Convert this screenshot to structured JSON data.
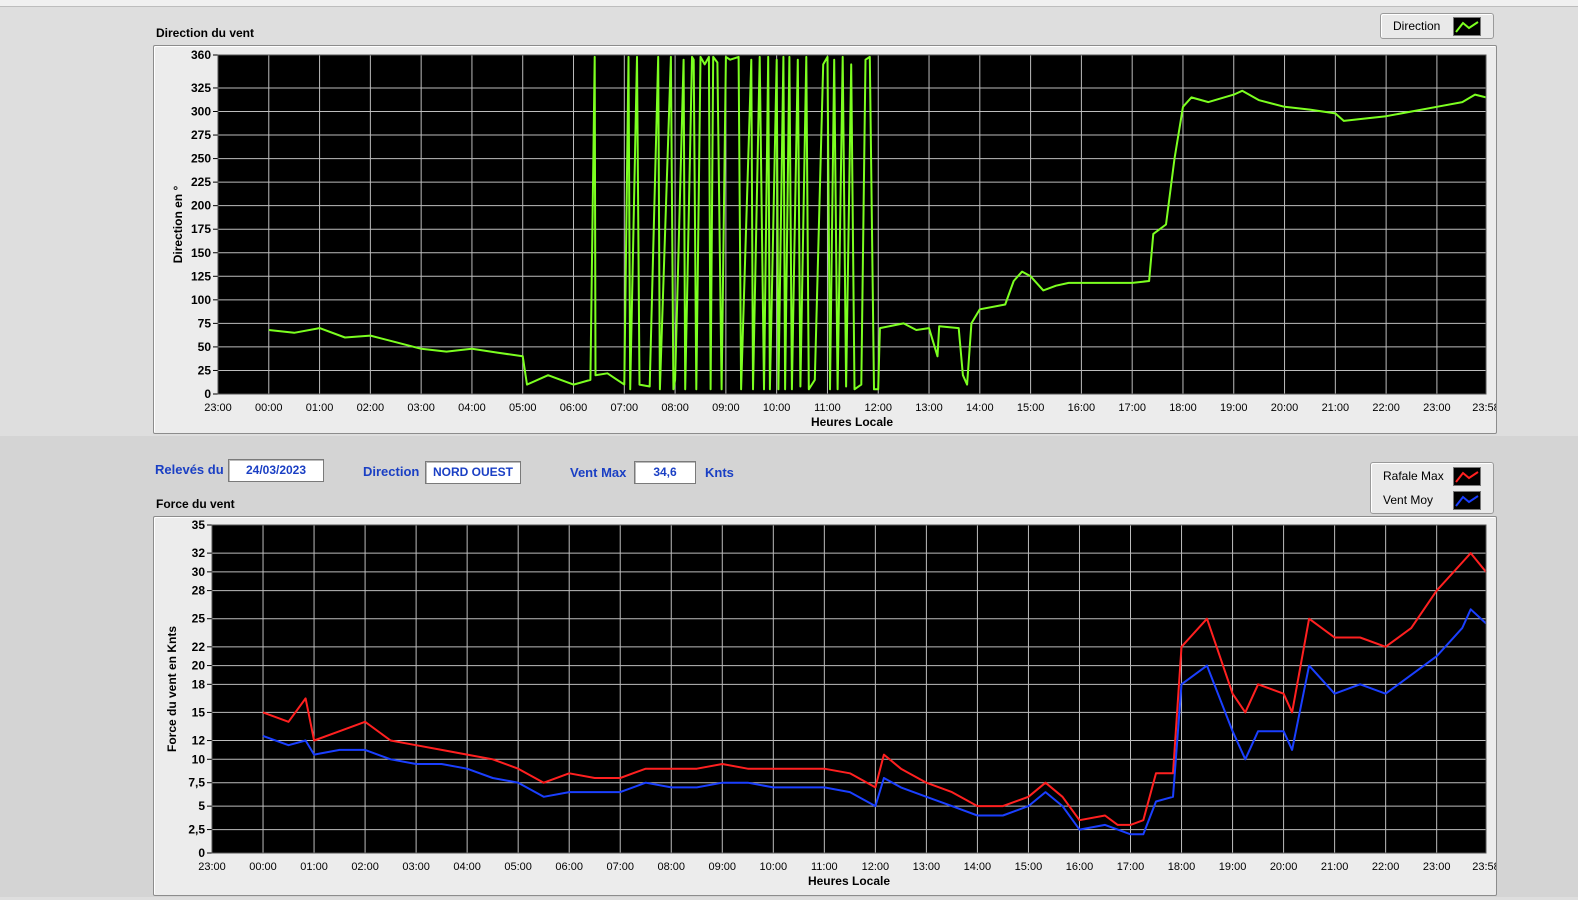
{
  "top_chart": {
    "title": "Direction du vent",
    "legend": [
      {
        "label": "Direction",
        "color": "#7cff20",
        "icon": "line-swatch-icon"
      }
    ],
    "chart_data": {
      "type": "line",
      "title": "Direction du vent",
      "xlabel": "Heures Locale",
      "ylabel": "Direction en °",
      "x_ticks": [
        "23:00",
        "00:00",
        "01:00",
        "02:00",
        "03:00",
        "04:00",
        "05:00",
        "06:00",
        "07:00",
        "08:00",
        "09:00",
        "10:00",
        "11:00",
        "12:00",
        "13:00",
        "14:00",
        "15:00",
        "16:00",
        "17:00",
        "18:00",
        "19:00",
        "20:00",
        "21:00",
        "22:00",
        "23:00",
        "23:58"
      ],
      "y_ticks": [
        "0",
        "25",
        "50",
        "75",
        "100",
        "125",
        "150",
        "175",
        "200",
        "225",
        "250",
        "275",
        "300",
        "325",
        "360"
      ],
      "ylim": [
        0,
        360
      ],
      "grid": true,
      "series": [
        {
          "name": "Direction",
          "color": "#7cff20",
          "points": [
            [
              "00:00",
              68
            ],
            [
              "00:30",
              65
            ],
            [
              "01:00",
              70
            ],
            [
              "01:30",
              60
            ],
            [
              "02:00",
              62
            ],
            [
              "02:30",
              55
            ],
            [
              "03:00",
              48
            ],
            [
              "03:30",
              45
            ],
            [
              "04:00",
              48
            ],
            [
              "04:30",
              44
            ],
            [
              "05:00",
              40
            ],
            [
              "05:05",
              10
            ],
            [
              "05:30",
              20
            ],
            [
              "06:00",
              10
            ],
            [
              "06:20",
              15
            ],
            [
              "06:25",
              358
            ],
            [
              "06:26",
              20
            ],
            [
              "06:40",
              22
            ],
            [
              "07:00",
              10
            ],
            [
              "07:05",
              358
            ],
            [
              "07:07",
              5
            ],
            [
              "07:15",
              358
            ],
            [
              "07:18",
              10
            ],
            [
              "07:30",
              8
            ],
            [
              "07:40",
              358
            ],
            [
              "07:42",
              5
            ],
            [
              "07:55",
              358
            ],
            [
              "07:58",
              5
            ],
            [
              "08:00",
              15
            ],
            [
              "08:10",
              355
            ],
            [
              "08:12",
              5
            ],
            [
              "08:20",
              358
            ],
            [
              "08:22",
              355
            ],
            [
              "08:25",
              5
            ],
            [
              "08:30",
              358
            ],
            [
              "08:35",
              350
            ],
            [
              "08:40",
              358
            ],
            [
              "08:42",
              5
            ],
            [
              "08:45",
              358
            ],
            [
              "08:50",
              352
            ],
            [
              "08:55",
              5
            ],
            [
              "09:00",
              358
            ],
            [
              "09:05",
              355
            ],
            [
              "09:15",
              358
            ],
            [
              "09:18",
              5
            ],
            [
              "09:30",
              355
            ],
            [
              "09:32",
              5
            ],
            [
              "09:40",
              358
            ],
            [
              "09:45",
              5
            ],
            [
              "09:50",
              358
            ],
            [
              "09:52",
              5
            ],
            [
              "10:00",
              355
            ],
            [
              "10:02",
              5
            ],
            [
              "10:08",
              358
            ],
            [
              "10:10",
              5
            ],
            [
              "10:15",
              358
            ],
            [
              "10:18",
              5
            ],
            [
              "10:25",
              355
            ],
            [
              "10:28",
              8
            ],
            [
              "10:35",
              358
            ],
            [
              "10:38",
              5
            ],
            [
              "10:45",
              15
            ],
            [
              "10:55",
              350
            ],
            [
              "11:00",
              358
            ],
            [
              "11:03",
              5
            ],
            [
              "11:08",
              355
            ],
            [
              "11:12",
              5
            ],
            [
              "11:18",
              358
            ],
            [
              "11:22",
              8
            ],
            [
              "11:28",
              350
            ],
            [
              "11:32",
              5
            ],
            [
              "11:40",
              10
            ],
            [
              "11:45",
              355
            ],
            [
              "11:50",
              358
            ],
            [
              "11:55",
              5
            ],
            [
              "12:00",
              5
            ],
            [
              "12:02",
              70
            ],
            [
              "12:30",
              75
            ],
            [
              "12:45",
              68
            ],
            [
              "13:00",
              70
            ],
            [
              "13:10",
              40
            ],
            [
              "13:12",
              72
            ],
            [
              "13:35",
              70
            ],
            [
              "13:40",
              20
            ],
            [
              "13:45",
              10
            ],
            [
              "13:50",
              75
            ],
            [
              "14:00",
              90
            ],
            [
              "14:30",
              95
            ],
            [
              "14:40",
              120
            ],
            [
              "14:50",
              130
            ],
            [
              "15:00",
              125
            ],
            [
              "15:15",
              110
            ],
            [
              "15:30",
              115
            ],
            [
              "15:45",
              118
            ],
            [
              "16:00",
              118
            ],
            [
              "17:00",
              118
            ],
            [
              "17:20",
              120
            ],
            [
              "17:25",
              170
            ],
            [
              "17:40",
              180
            ],
            [
              "17:50",
              250
            ],
            [
              "18:00",
              305
            ],
            [
              "18:10",
              315
            ],
            [
              "18:30",
              310
            ],
            [
              "19:00",
              318
            ],
            [
              "19:10",
              322
            ],
            [
              "19:30",
              312
            ],
            [
              "20:00",
              305
            ],
            [
              "20:30",
              302
            ],
            [
              "21:00",
              298
            ],
            [
              "21:10",
              290
            ],
            [
              "21:30",
              292
            ],
            [
              "22:00",
              295
            ],
            [
              "22:30",
              300
            ],
            [
              "23:00",
              305
            ],
            [
              "23:30",
              310
            ],
            [
              "23:45",
              318
            ],
            [
              "23:58",
              315
            ]
          ]
        }
      ]
    }
  },
  "info": {
    "date_label": "Relevés du",
    "date_value": "24/03/2023",
    "direction_label": "Direction",
    "direction_value": "NORD OUEST",
    "ventmax_label": "Vent Max",
    "ventmax_value": "34,6",
    "unit": "Knts"
  },
  "bottom_chart": {
    "title": "Force du vent",
    "legend": [
      {
        "label": "Rafale Max",
        "color": "#ff2020",
        "icon": "line-swatch-icon"
      },
      {
        "label": "Vent Moy",
        "color": "#1a3fff",
        "icon": "line-swatch-icon"
      }
    ],
    "chart_data": {
      "type": "line",
      "title": "Force du vent",
      "xlabel": "Heures Locale",
      "ylabel": "Force du vent en Knts",
      "x_ticks": [
        "23:00",
        "00:00",
        "01:00",
        "02:00",
        "03:00",
        "04:00",
        "05:00",
        "06:00",
        "07:00",
        "08:00",
        "09:00",
        "10:00",
        "11:00",
        "12:00",
        "13:00",
        "14:00",
        "15:00",
        "16:00",
        "17:00",
        "18:00",
        "19:00",
        "20:00",
        "21:00",
        "22:00",
        "23:00",
        "23:58"
      ],
      "y_ticks": [
        "0",
        "2,5",
        "5",
        "7,5",
        "10",
        "12",
        "15",
        "18",
        "20",
        "22",
        "25",
        "28",
        "30",
        "32",
        "35"
      ],
      "ylim": [
        0,
        35
      ],
      "grid": true,
      "series": [
        {
          "name": "Rafale Max",
          "color": "#ff2020",
          "points": [
            [
              "00:00",
              15
            ],
            [
              "00:30",
              14
            ],
            [
              "00:50",
              16.5
            ],
            [
              "01:00",
              12
            ],
            [
              "01:30",
              13
            ],
            [
              "02:00",
              14
            ],
            [
              "02:30",
              12
            ],
            [
              "03:00",
              11.5
            ],
            [
              "03:30",
              11
            ],
            [
              "04:00",
              10.5
            ],
            [
              "04:30",
              10
            ],
            [
              "05:00",
              9
            ],
            [
              "05:30",
              7.5
            ],
            [
              "06:00",
              8.5
            ],
            [
              "06:30",
              8
            ],
            [
              "07:00",
              8
            ],
            [
              "07:30",
              9
            ],
            [
              "08:00",
              9
            ],
            [
              "08:30",
              9
            ],
            [
              "09:00",
              9.5
            ],
            [
              "09:30",
              9
            ],
            [
              "10:00",
              9
            ],
            [
              "10:30",
              9
            ],
            [
              "11:00",
              9
            ],
            [
              "11:30",
              8.5
            ],
            [
              "12:00",
              7
            ],
            [
              "12:10",
              10.5
            ],
            [
              "12:30",
              9
            ],
            [
              "13:00",
              7.5
            ],
            [
              "13:30",
              6.5
            ],
            [
              "14:00",
              5
            ],
            [
              "14:30",
              5
            ],
            [
              "15:00",
              6
            ],
            [
              "15:20",
              7.5
            ],
            [
              "15:40",
              6
            ],
            [
              "16:00",
              3.5
            ],
            [
              "16:30",
              4
            ],
            [
              "16:45",
              3
            ],
            [
              "17:00",
              3
            ],
            [
              "17:15",
              3.5
            ],
            [
              "17:30",
              8.5
            ],
            [
              "17:50",
              8.5
            ],
            [
              "18:00",
              22
            ],
            [
              "18:30",
              25
            ],
            [
              "19:00",
              17
            ],
            [
              "19:15",
              15
            ],
            [
              "19:30",
              18
            ],
            [
              "20:00",
              17
            ],
            [
              "20:10",
              15
            ],
            [
              "20:30",
              25
            ],
            [
              "21:00",
              23
            ],
            [
              "21:30",
              23
            ],
            [
              "22:00",
              22
            ],
            [
              "22:30",
              24
            ],
            [
              "23:00",
              28
            ],
            [
              "23:30",
              31
            ],
            [
              "23:40",
              32
            ],
            [
              "23:58",
              30
            ]
          ]
        },
        {
          "name": "Vent Moy",
          "color": "#1a3fff",
          "points": [
            [
              "00:00",
              12.5
            ],
            [
              "00:30",
              11.5
            ],
            [
              "00:50",
              12
            ],
            [
              "01:00",
              10.5
            ],
            [
              "01:30",
              11
            ],
            [
              "02:00",
              11
            ],
            [
              "02:30",
              10
            ],
            [
              "03:00",
              9.5
            ],
            [
              "03:30",
              9.5
            ],
            [
              "04:00",
              9
            ],
            [
              "04:30",
              8
            ],
            [
              "05:00",
              7.5
            ],
            [
              "05:30",
              6
            ],
            [
              "06:00",
              6.5
            ],
            [
              "06:30",
              6.5
            ],
            [
              "07:00",
              6.5
            ],
            [
              "07:30",
              7.5
            ],
            [
              "08:00",
              7
            ],
            [
              "08:30",
              7
            ],
            [
              "09:00",
              7.5
            ],
            [
              "09:30",
              7.5
            ],
            [
              "10:00",
              7
            ],
            [
              "10:30",
              7
            ],
            [
              "11:00",
              7
            ],
            [
              "11:30",
              6.5
            ],
            [
              "12:00",
              5
            ],
            [
              "12:10",
              8
            ],
            [
              "12:30",
              7
            ],
            [
              "13:00",
              6
            ],
            [
              "13:30",
              5
            ],
            [
              "14:00",
              4
            ],
            [
              "14:30",
              4
            ],
            [
              "15:00",
              5
            ],
            [
              "15:20",
              6.5
            ],
            [
              "15:40",
              5
            ],
            [
              "16:00",
              2.5
            ],
            [
              "16:30",
              3
            ],
            [
              "16:45",
              2.5
            ],
            [
              "17:00",
              2
            ],
            [
              "17:15",
              2
            ],
            [
              "17:30",
              5.5
            ],
            [
              "17:50",
              6
            ],
            [
              "18:00",
              18
            ],
            [
              "18:30",
              20
            ],
            [
              "19:00",
              13
            ],
            [
              "19:15",
              10
            ],
            [
              "19:30",
              13
            ],
            [
              "20:00",
              13
            ],
            [
              "20:10",
              11
            ],
            [
              "20:30",
              20
            ],
            [
              "21:00",
              17
            ],
            [
              "21:30",
              18
            ],
            [
              "22:00",
              17
            ],
            [
              "22:30",
              19
            ],
            [
              "23:00",
              21
            ],
            [
              "23:30",
              24
            ],
            [
              "23:40",
              26
            ],
            [
              "23:58",
              24.5
            ]
          ]
        }
      ]
    }
  }
}
